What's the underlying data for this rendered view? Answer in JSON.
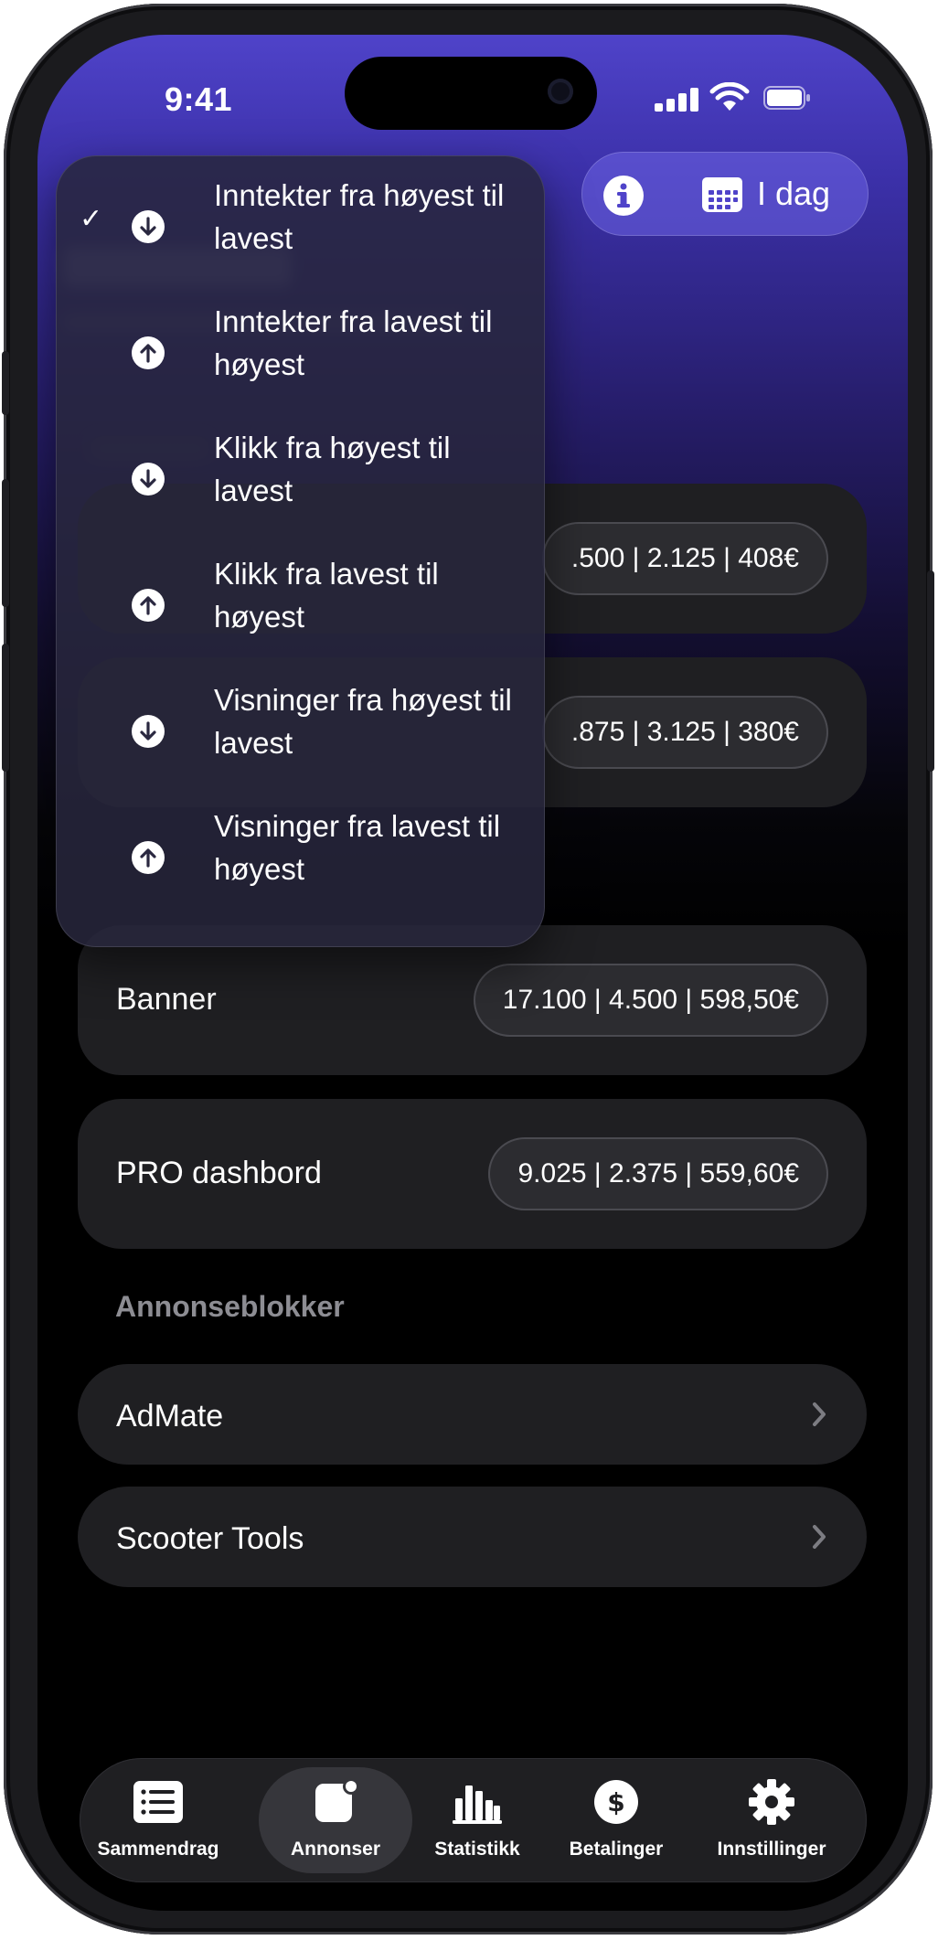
{
  "status_bar": {
    "time": "9:41"
  },
  "header": {
    "info_icon": "info-icon",
    "calendar_icon": "calendar-icon",
    "date_label": "I dag"
  },
  "sort_menu": {
    "items": [
      {
        "label": "Inntekter fra høyest til lavest",
        "direction": "down",
        "selected": true
      },
      {
        "label": "Inntekter fra lavest til høyest",
        "direction": "up",
        "selected": false
      },
      {
        "label": "Klikk fra høyest til lavest",
        "direction": "down",
        "selected": false
      },
      {
        "label": "Klikk fra lavest til høyest",
        "direction": "up",
        "selected": false
      },
      {
        "label": "Visninger fra høyest til lavest",
        "direction": "down",
        "selected": false
      },
      {
        "label": "Visninger fra lavest til høyest",
        "direction": "up",
        "selected": false
      }
    ],
    "check_mark": "✓"
  },
  "ad_cards": [
    {
      "label": "",
      "stats": ".500 | 2.125 | 408€"
    },
    {
      "label": "",
      "stats": ".875 | 3.125 | 380€"
    },
    {
      "label": "Banner",
      "stats": "17.100 | 4.500 | 598,50€"
    },
    {
      "label": "PRO dashbord",
      "stats": "9.025 | 2.375 | 559,60€"
    }
  ],
  "adblockers": {
    "title": "Annonseblokker",
    "items": [
      {
        "label": "AdMate"
      },
      {
        "label": "Scooter Tools"
      }
    ]
  },
  "tab_bar": {
    "tabs": [
      {
        "label": "Sammendrag",
        "icon": "list-icon",
        "active": false
      },
      {
        "label": "Annonser",
        "icon": "ads-badge-icon",
        "active": true
      },
      {
        "label": "Statistikk",
        "icon": "bar-chart-icon",
        "active": false
      },
      {
        "label": "Betalinger",
        "icon": "dollar-icon",
        "active": false
      },
      {
        "label": "Innstillinger",
        "icon": "gear-icon",
        "active": false
      }
    ]
  },
  "colors": {
    "accent": "#4f43c9",
    "card": "#1f1f22",
    "muted_text": "#8d8d93"
  }
}
